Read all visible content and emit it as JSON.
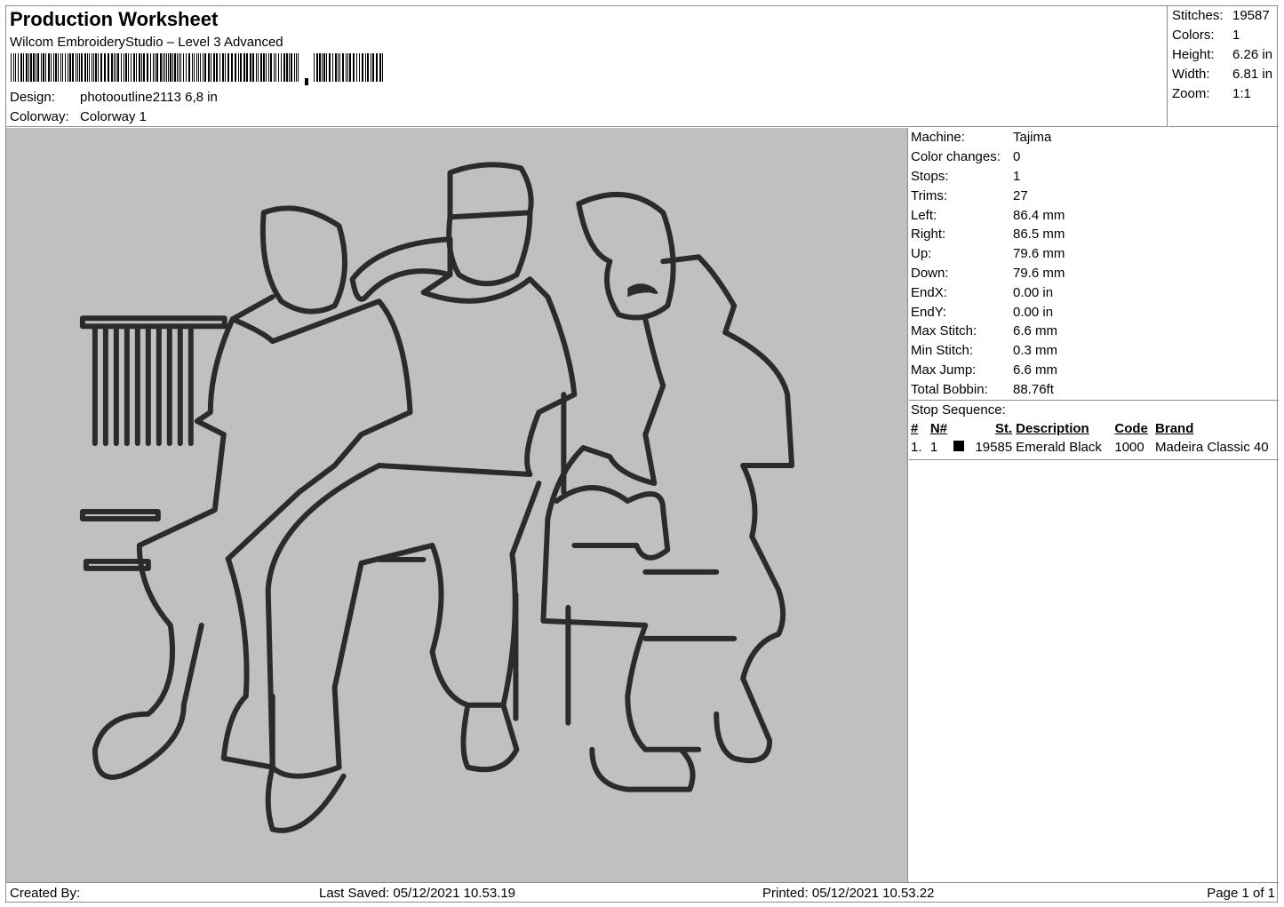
{
  "header": {
    "title": "Production Worksheet",
    "software": "Wilcom EmbroideryStudio – Level 3 Advanced",
    "design_label": "Design:",
    "design_value": "photooutline2113 6,8 in",
    "colorway_label": "Colorway:",
    "colorway_value": "Colorway 1"
  },
  "stats": [
    {
      "label": "Stitches:",
      "value": "19587"
    },
    {
      "label": "Colors:",
      "value": "1"
    },
    {
      "label": "Height:",
      "value": "6.26 in"
    },
    {
      "label": "Width:",
      "value": "6.81 in"
    },
    {
      "label": "Zoom:",
      "value": "1:1"
    }
  ],
  "machine_info": [
    {
      "label": "Machine:",
      "value": "Tajima"
    },
    {
      "label": "Color changes:",
      "value": "0"
    },
    {
      "label": "Stops:",
      "value": "1"
    },
    {
      "label": "Trims:",
      "value": "27"
    },
    {
      "label": "Left:",
      "value": "86.4 mm"
    },
    {
      "label": "Right:",
      "value": "86.5 mm"
    },
    {
      "label": "Up:",
      "value": "79.6 mm"
    },
    {
      "label": "Down:",
      "value": "79.6 mm"
    },
    {
      "label": "EndX:",
      "value": "0.00 in"
    },
    {
      "label": "EndY:",
      "value": "0.00 in"
    },
    {
      "label": "Max Stitch:",
      "value": "6.6 mm"
    },
    {
      "label": "Min Stitch:",
      "value": "0.3 mm"
    },
    {
      "label": "Max Jump:",
      "value": "6.6 mm"
    },
    {
      "label": "Total Bobbin:",
      "value": "88.76ft"
    }
  ],
  "stop_sequence": {
    "title": "Stop Sequence:",
    "columns": [
      "#",
      "N#",
      "St.",
      "Description",
      "Code",
      "Brand"
    ],
    "rows": [
      {
        "index": "1.",
        "n": "1",
        "color": "#000000",
        "stitches": "19585",
        "description": "Emerald Black",
        "code": "1000",
        "brand": "Madeira Classic 40"
      }
    ]
  },
  "colors": {
    "canvas_bg": "#c0c0c0",
    "thread": "#2b2b2b"
  },
  "footer": {
    "created_by": "Created By:",
    "last_saved": "Last Saved: 05/12/2021 10.53.19",
    "printed": "Printed: 05/12/2021 10.53.22",
    "page": "Page 1 of 1"
  }
}
